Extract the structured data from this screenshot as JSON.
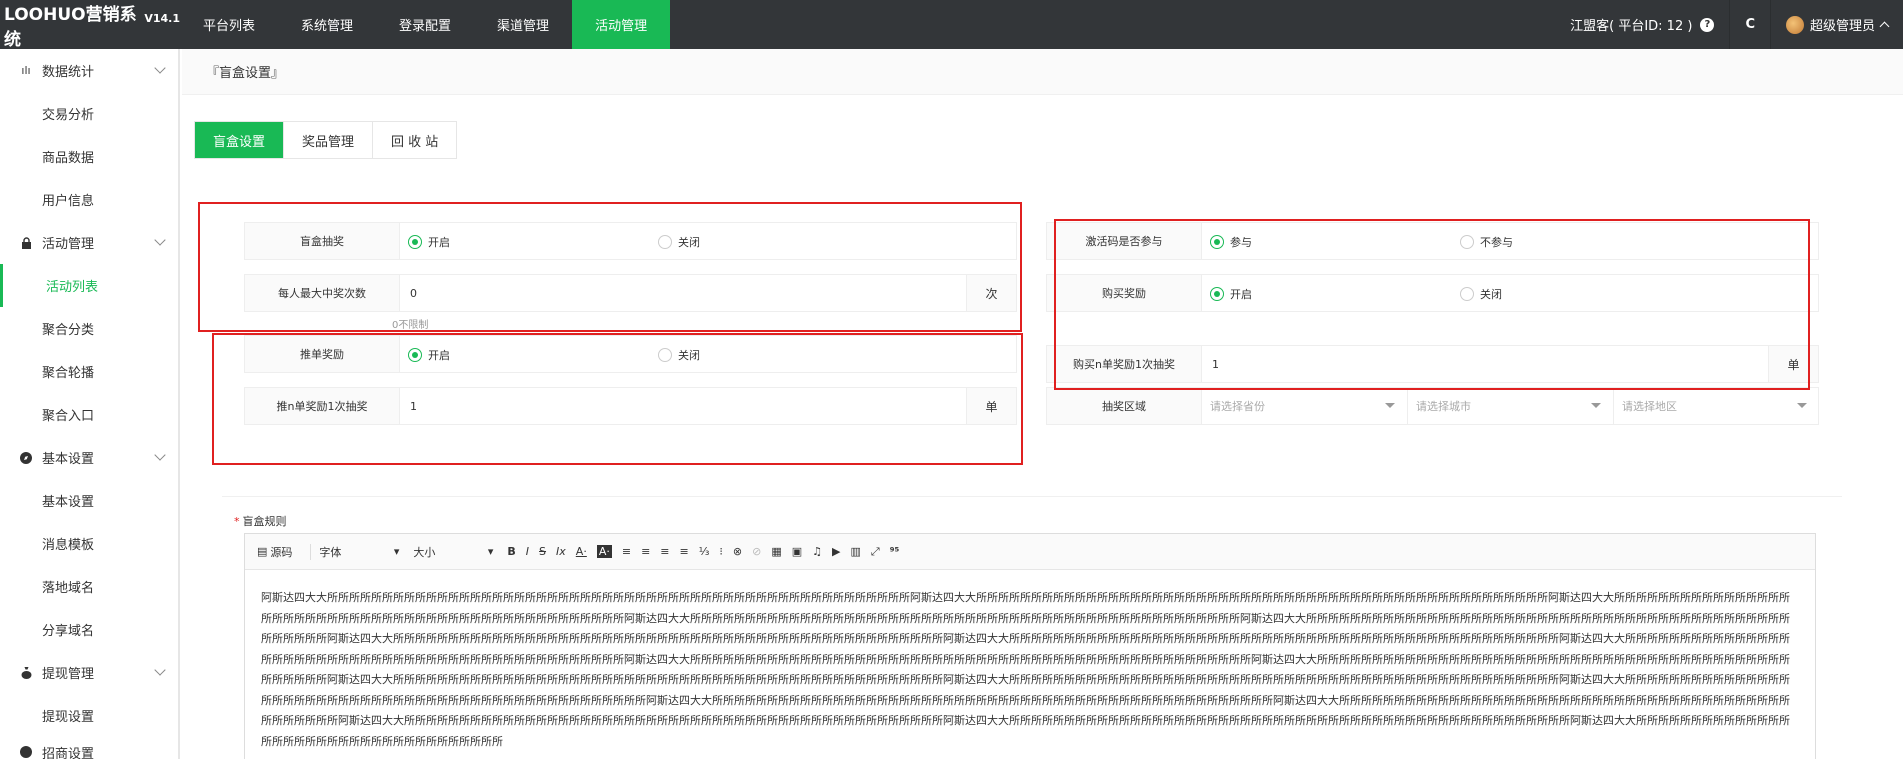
{
  "topbar": {
    "brand": "LOOHUO营销系统",
    "version": "V14.1",
    "nav": [
      {
        "label": "平台列表",
        "active": false
      },
      {
        "label": "系统管理",
        "active": false
      },
      {
        "label": "登录配置",
        "active": false
      },
      {
        "label": "渠道管理",
        "active": false
      },
      {
        "label": "活动管理",
        "active": true
      }
    ],
    "platform": "江盟客( 平台ID: 12 )",
    "help_icon": "?",
    "refresh_icon": "C",
    "user": "超级管理员"
  },
  "sidebar": {
    "groups": [
      {
        "label": "数据统计",
        "icon": "ılı",
        "items": [
          "交易分析",
          "商品数据",
          "用户信息"
        ]
      },
      {
        "label": "活动管理",
        "icon": "🔒",
        "items": [
          "活动列表",
          "聚合分类",
          "聚合轮播",
          "聚合入口"
        ]
      },
      {
        "label": "基本设置",
        "icon": "⊘",
        "items": [
          "基本设置",
          "消息模板",
          "落地域名",
          "分享域名"
        ]
      },
      {
        "label": "提现管理",
        "icon": "♁",
        "items": [
          "提现设置"
        ]
      },
      {
        "label": "招商设置",
        "icon": "●",
        "items": []
      }
    ],
    "active_item": "活动列表"
  },
  "breadcrumb": "『盲盒设置』",
  "tabs": [
    "盲盒设置",
    "奖品管理",
    "回 收 站"
  ],
  "form": {
    "blindbox": {
      "label": "盲盒抽奖",
      "on": "开启",
      "off": "关闭",
      "value": "on"
    },
    "max_wins": {
      "label": "每人最大中奖次数",
      "value": "0",
      "suffix": "次",
      "hint": "0不限制"
    },
    "push_reward": {
      "label": "推单奖励",
      "on": "开启",
      "off": "关闭",
      "value": "on"
    },
    "push_n": {
      "label": "推n单奖励1次抽奖",
      "value": "1",
      "suffix": "单"
    },
    "activation": {
      "label": "激活码是否参与",
      "on": "参与",
      "off": "不参与",
      "value": "on"
    },
    "purchase_reward": {
      "label": "购买奖励",
      "on": "开启",
      "off": "关闭",
      "value": "on"
    },
    "buy_n": {
      "label": "购买n单奖励1次抽奖",
      "value": "1",
      "suffix": "单"
    },
    "region": {
      "label": "抽奖区域",
      "province": "请选择省份",
      "city": "请选择城市",
      "district": "请选择地区"
    }
  },
  "rules": {
    "label": "盲盒规则",
    "toolbar": {
      "source": "源码",
      "font": "字体",
      "size": "大小",
      "buttons": [
        "B",
        "I",
        "S",
        "Ix",
        "A·",
        "A·",
        "≡",
        "≡",
        "≡",
        "≡",
        "⅓",
        "⁝",
        "⊗",
        "⊘",
        "▦",
        "▣",
        "♫",
        "▶",
        "▥",
        "⤢",
        "⁹⁵"
      ]
    },
    "content": "阿斯达四大大所所所所所所所所所所所所所所所所所所所所所所所所所所所所所所所所所所所所所所所所所所所所所所所所所所所所所阿斯达四大大所所所所所所所所所所所所所所所所所所所所所所所所所所所所所所所所所所所所所所所所所所所所所所所所所所所所阿斯达四大大所所所所所所所所所所所所所所所所所所所所所所所所所所所所所所所所所所所所所所所所所所所所所所所所所阿斯达四大大所所所所所所所所所所所所所所所所所所所所所所所所所所所所所所所所所所所所所所所所所所所所所所所所所所阿斯达四大大所所所所所所所所所所所所所所所所所所所所所所所所所所所所所所所所所所所所所所所所所所所所所所所所所所阿斯达四大大所所所所所所所所所所所所所所所所所所所所所所所所所所所所所所所所所所所所所所所所所所所所所所所所所所阿斯达四大大所所所所所所所所所所所所所所所所所所所所所所所所所所所所所所所所所所所所所所所所所所所所所所所所所所阿斯达四大大所所所所所所所所所所所所所所所所所所所所所所所所所所所所所所所所所所所所所所所所所所所所所所所所阿斯达四大大所所所所所所所所所所所所所所所所所所所所所所所所所所所所所所所所所所所所所所所所所所所所所所所所所所所阿斯达四大大所所所所所所所所所所所所所所所所所所所所所所所所所所所所所所所所所所所所所所所所所所所所所所所所所阿斯达四大大所所所所所所所所所所所所所所所所所所所所所所所所所所所所所所所所所所所所所所所所所所所所所所所所所所阿斯达四大大所所所所所所所所所所所所所所所所所所所所所所所所所所所所所所所所所所所所所所所所所所所所所所所所所所阿斯达四大大所所所所所所所所所所所所所所所所所所所所所所所所所所所所所所所所所所所所所所所所所所所所所所所所所所阿斯达四大大所所所所所所所所所所所所所所所所所所所所所所所所所所所所所所所所所所所所所所所所所所所所所所所所所所所阿斯达四大大所所所所所所所所所所所所所所所所所所所所所所所所所所所所所所所所所所所所所所所所所所所所所所所所阿斯达四大大所所所所所所所所所所所所所所所所所所所所所所所所所所所所所所所所所所所所所所所所所所所所所所所所所阿斯达四大大所所所所所所所所所所所所所所所所所所所所所所所所所所所所所所所所所所所所所所所所所所所所所所所所所所所阿斯达四大大所所所所所所所所所所所所所所所所所所所所所所所所所所所所所所所所所所所所"
  },
  "colors": {
    "accent": "#19b955",
    "topbar": "#333639",
    "annotation": "#e02020"
  }
}
